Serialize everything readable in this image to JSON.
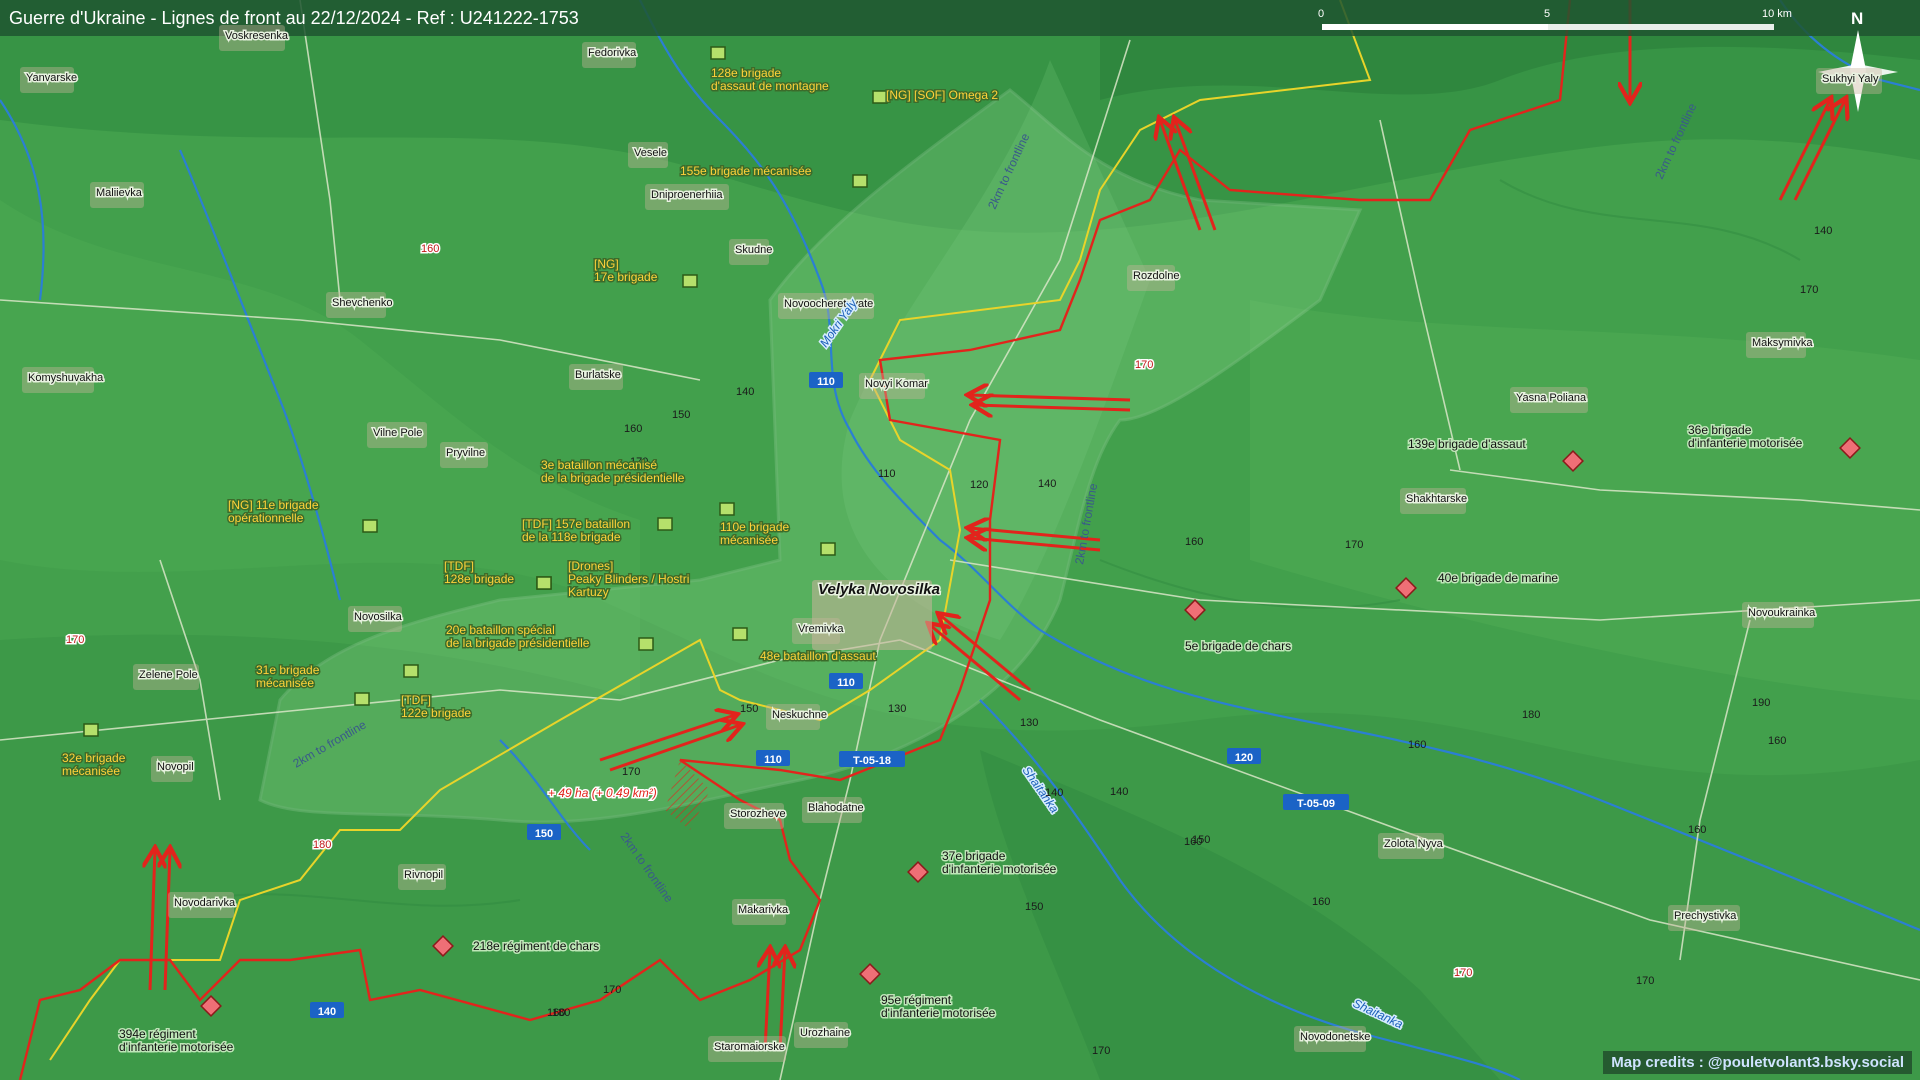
{
  "title": "Guerre d'Ukraine - Lignes de front au 22/12/2024 - Ref : U241222-1753",
  "credits": "Map credits : @pouletvolant3.bsky.social",
  "scale": {
    "ticks": [
      "0",
      "5",
      "10 km"
    ]
  },
  "north_label": "N",
  "colors": {
    "front_line": "#e2241c",
    "previous_line": "#e8d42a",
    "ua_unit": "#b5e06b",
    "ru_unit": "#ef6f76",
    "ua_text": "#ffd23a",
    "ru_text": "#111111",
    "road_badge": "#1b63c6"
  },
  "towns": [
    "Voskresenka",
    "Yanvarske",
    "Fedorivka",
    "Maliievka",
    "Vesele",
    "Dniproenerhiia",
    "Skudne",
    "Shevchenko",
    "Novoocheretuvate",
    "Rozdolne",
    "Burlatske",
    "Komyshuvakha",
    "Novyi Komar",
    "Vilne Pole",
    "Pryvilne",
    "Velyka Novosilka",
    "Vremivka",
    "Novosilka",
    "Zelene Pole",
    "Neskuchne",
    "Novopil",
    "Storozheve",
    "Blahodatne",
    "Rivnopil",
    "Novodarivka",
    "Makarivka",
    "Urozhaine",
    "Staromaiorske",
    "Yasna Poliana",
    "Shakhtarske",
    "Maksymivka",
    "Novoukrainka",
    "Zolota Nyva",
    "Prechystivka",
    "Novodonetske",
    "Sukhyi Yaly"
  ],
  "rivers": [
    "Mokri Yaly",
    "Shaitanka",
    "Shaitanka"
  ],
  "buffer_labels": [
    "2km to frontline",
    "2km to frontline",
    "2km to frontline",
    "2km to frontline",
    "2km to frontline"
  ],
  "roads": [
    "110",
    "110",
    "110",
    "150",
    "T-05-18",
    "T-05-09",
    "120",
    "140"
  ],
  "elevations": [
    "160",
    "170",
    "160",
    "140",
    "150",
    "170",
    "110",
    "120",
    "140",
    "160",
    "170",
    "170",
    "150",
    "180",
    "170",
    "130",
    "130",
    "140",
    "140",
    "150",
    "160",
    "150",
    "160",
    "170",
    "160",
    "160",
    "140",
    "170",
    "180",
    "190",
    "160",
    "170",
    "160",
    "170",
    "180",
    "170"
  ],
  "gain_label": "+ 49 ha (+ 0.49 km²)",
  "ua_units": [
    "128e brigade\nd'assaut de montagne",
    "[NG] [SOF] Omega 2",
    "155e brigade mécanisée",
    "[NG]\n17e brigade",
    "3e bataillon mécanisé\nde la brigade présidentielle",
    "[NG] 11e brigade\nopérationnelle",
    "[TDF] 157e bataillon\nde la 118e brigade",
    "110e brigade\nmécanisée",
    "[TDF]\n128e brigade",
    "[Drones]\nPeaky Blinders / Hostri\nKartuzy",
    "20e bataillon spécial\nde la brigade présidentielle",
    "48e bataillon d'assaut",
    "31e brigade\nmécanisée",
    "[TDF]\n122e brigade",
    "32e brigade\nmécanisée"
  ],
  "ru_units": [
    "139e brigade d'assaut",
    "36e brigade\nd'infanterie motorisée",
    "40e brigade de marine",
    "5e brigade de chars",
    "37e brigade\nd'infanterie motorisée",
    "218e régiment de chars",
    "95e régiment\nd'infanterie motorisée",
    "394e régiment\nd'infanterie motorisée"
  ]
}
